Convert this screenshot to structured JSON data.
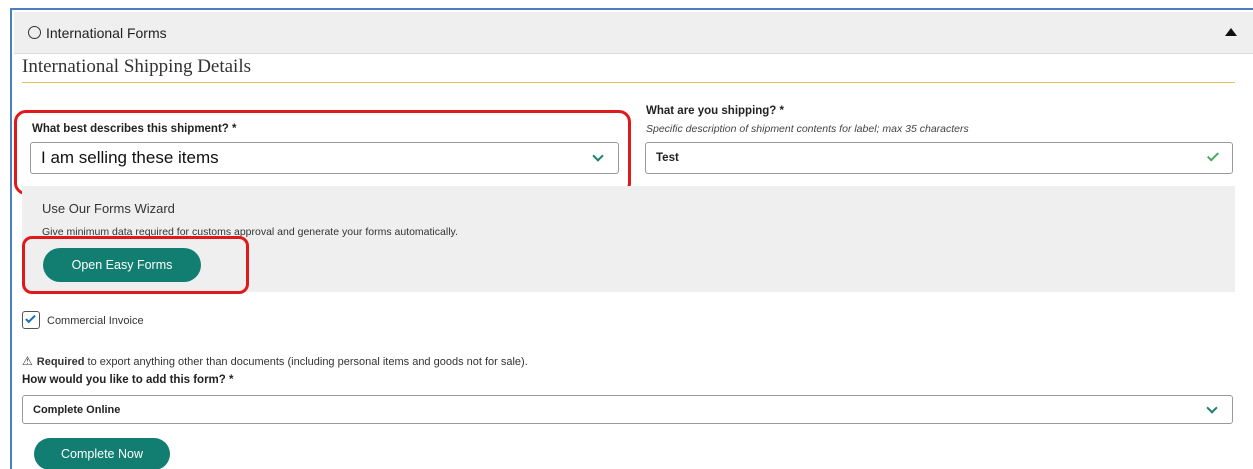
{
  "accordion": {
    "title": "International Forms"
  },
  "section": {
    "title": "International Shipping Details"
  },
  "shipment_type": {
    "label": "What best describes this shipment? *",
    "value": "I am selling these items"
  },
  "contents": {
    "label": "What are you shipping? *",
    "helper": "Specific description of shipment contents for label; max 35 characters",
    "value": "Test"
  },
  "wizard": {
    "title": "Use Our Forms Wizard",
    "description": "Give minimum data required for customs approval and generate your forms automatically.",
    "button_label": "Open Easy Forms"
  },
  "commercial_invoice": {
    "label": "Commercial Invoice",
    "checked": true
  },
  "requirement": {
    "bold": "Required",
    "text": " to export anything other than documents (including personal items and goods not for sale)."
  },
  "add_form": {
    "label": "How would you like to add this form? *",
    "value": "Complete Online"
  },
  "complete_button": {
    "label": "Complete Now"
  },
  "colors": {
    "accent_teal": "#127e72",
    "highlight_red": "#e01a1a",
    "rule_gold": "#e3c35a",
    "frame_blue": "#4a7fc1"
  }
}
